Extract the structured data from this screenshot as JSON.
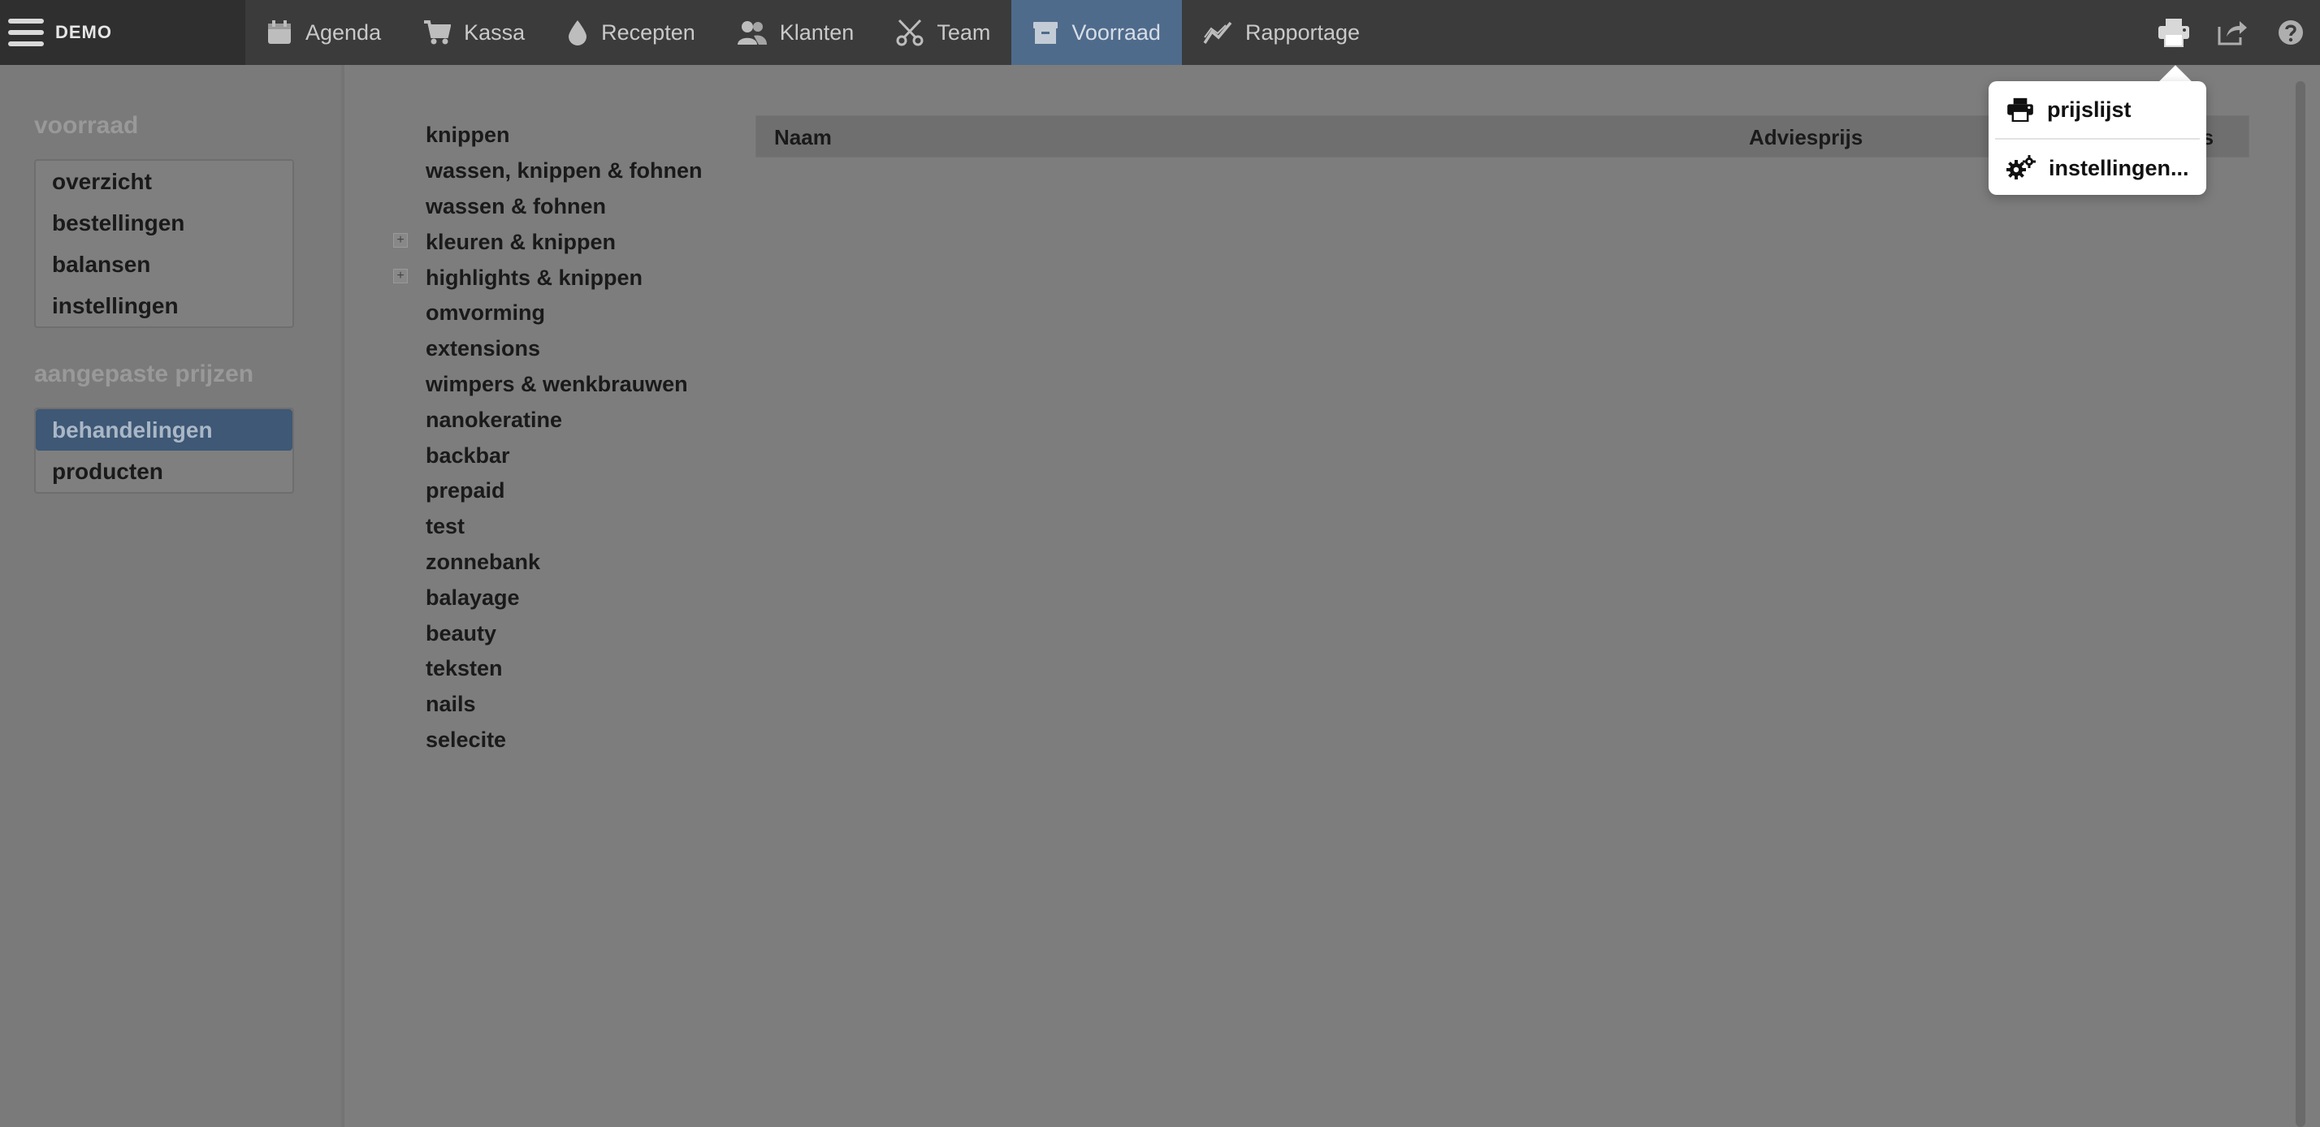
{
  "app": {
    "brand": "DEMO"
  },
  "nav": [
    {
      "label": "Agenda",
      "icon": "calendar-icon"
    },
    {
      "label": "Kassa",
      "icon": "cart-icon"
    },
    {
      "label": "Recepten",
      "icon": "drop-icon"
    },
    {
      "label": "Klanten",
      "icon": "users-icon"
    },
    {
      "label": "Team",
      "icon": "scissors-icon"
    },
    {
      "label": "Voorraad",
      "icon": "box-icon",
      "active": true
    },
    {
      "label": "Rapportage",
      "icon": "chart-line-icon"
    }
  ],
  "top_right_icons": [
    "printer-icon",
    "share-icon",
    "help-icon"
  ],
  "sidebar": {
    "section1": {
      "heading": "voorraad",
      "items": [
        "overzicht",
        "bestellingen",
        "balansen",
        "instellingen"
      ]
    },
    "section2": {
      "heading": "aangepaste prijzen",
      "items": [
        "behandelingen",
        "producten"
      ],
      "selected": "behandelingen"
    }
  },
  "categories": [
    {
      "label": "knippen"
    },
    {
      "label": "wassen, knippen & fohnen"
    },
    {
      "label": "wassen & fohnen"
    },
    {
      "label": "kleuren & knippen",
      "expandable": true
    },
    {
      "label": "highlights & knippen",
      "expandable": true
    },
    {
      "label": "omvorming"
    },
    {
      "label": "extensions"
    },
    {
      "label": "wimpers & wenkbrauwen"
    },
    {
      "label": "nanokeratine"
    },
    {
      "label": "backbar"
    },
    {
      "label": "prepaid"
    },
    {
      "label": "test"
    },
    {
      "label": "zonnebank"
    },
    {
      "label": "balayage"
    },
    {
      "label": "beauty"
    },
    {
      "label": "teksten"
    },
    {
      "label": "nails"
    },
    {
      "label": "selecite"
    }
  ],
  "expander_symbol": "+",
  "table": {
    "columns": [
      "Naam",
      "Adviesprijs",
      "rijs"
    ]
  },
  "popup": {
    "items": [
      {
        "label": "prijslijst",
        "icon": "printer-icon"
      },
      {
        "label": "instellingen...",
        "icon": "gears-icon"
      }
    ]
  },
  "colors": {
    "topbar": "#3b3b3b",
    "active_nav": "#4f6b8c",
    "selected_sidebar": "#3e5876",
    "overlay_bg": "#7d7d7d"
  }
}
